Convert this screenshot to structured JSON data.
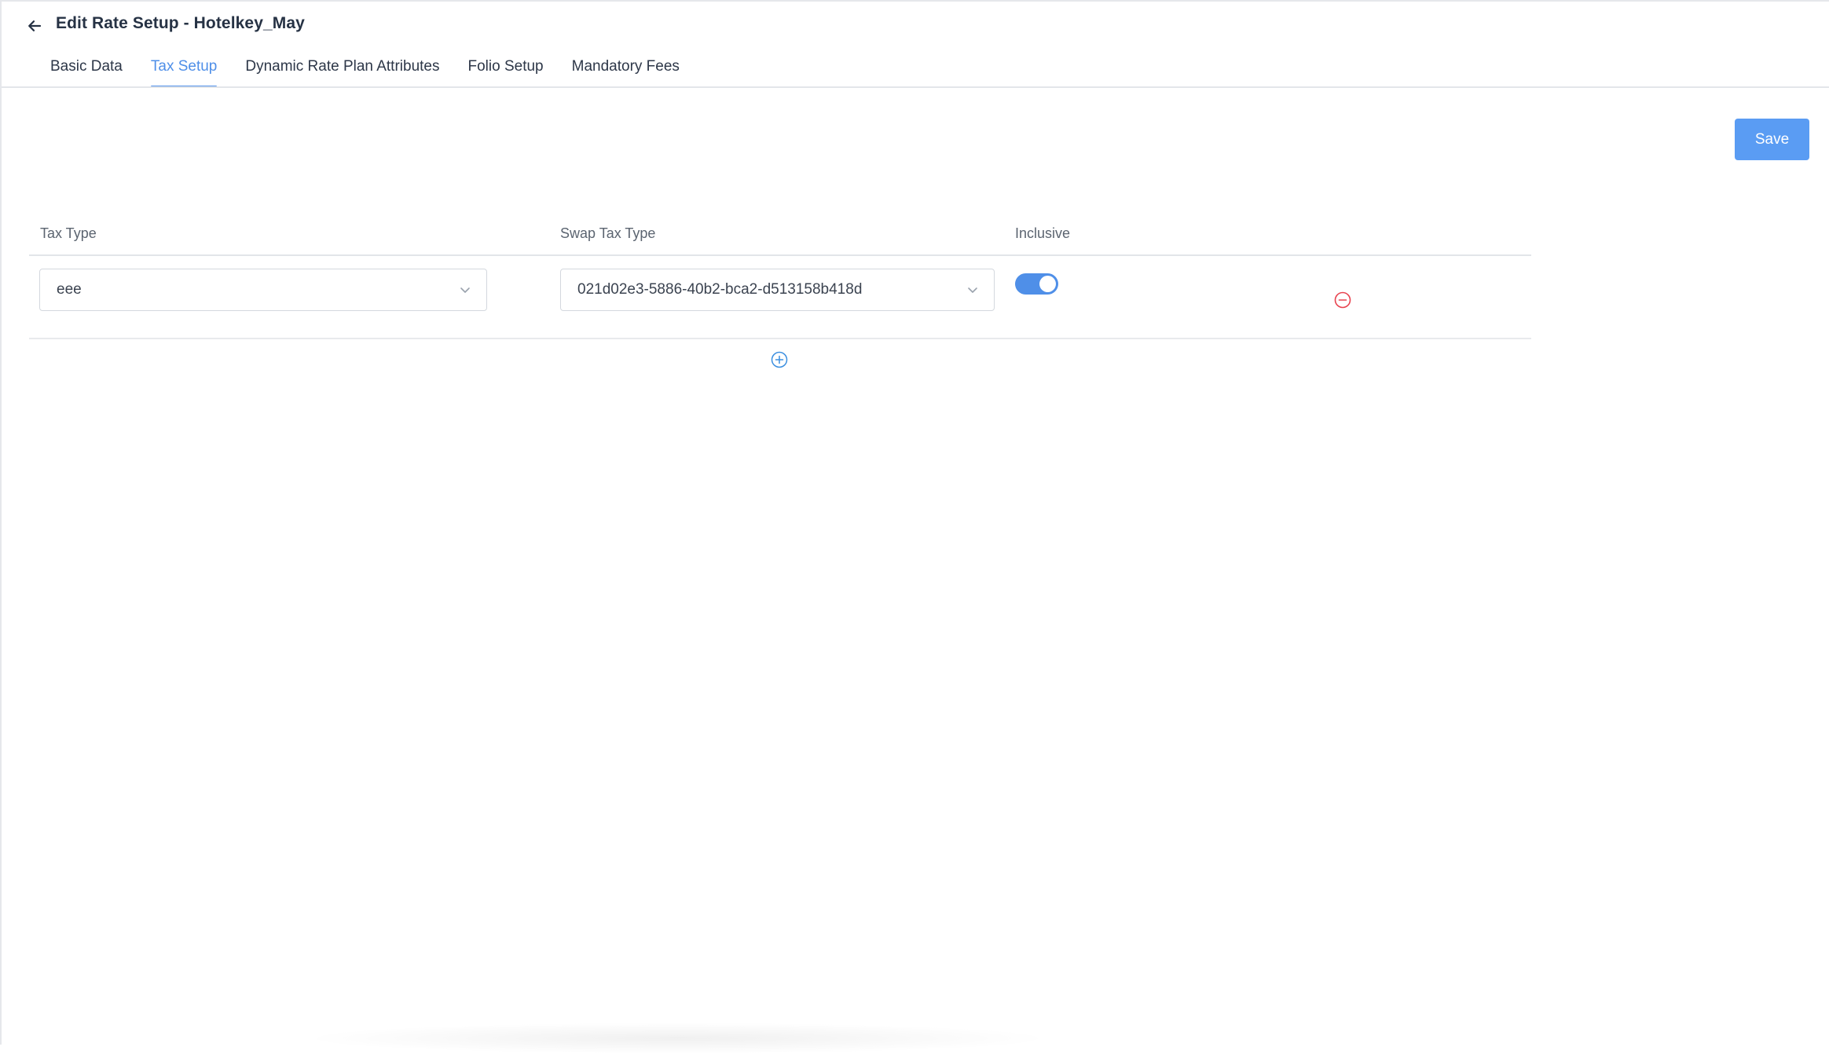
{
  "header": {
    "title": "Edit Rate Setup - Hotelkey_May",
    "back_icon": "arrow-left-icon"
  },
  "tabs": [
    {
      "label": "Basic Data",
      "active": false
    },
    {
      "label": "Tax Setup",
      "active": true
    },
    {
      "label": "Dynamic Rate Plan Attributes",
      "active": false
    },
    {
      "label": "Folio Setup",
      "active": false
    },
    {
      "label": "Mandatory Fees",
      "active": false
    }
  ],
  "toolbar": {
    "save_label": "Save"
  },
  "tax_table": {
    "columns": [
      "Tax Type",
      "Swap Tax Type",
      "Inclusive"
    ],
    "rows": [
      {
        "tax_type": "eee",
        "swap_tax_type": "021d02e3-5886-40b2-bca2-d513158b418d",
        "inclusive": true
      }
    ]
  },
  "colors": {
    "accent": "#4f8fe8",
    "save_button": "#5a9cf3",
    "danger": "#e8434f"
  },
  "icons": {
    "remove_row": "minus-circle-icon",
    "add_row": "plus-circle-icon",
    "dropdown": "chevron-down-icon"
  }
}
